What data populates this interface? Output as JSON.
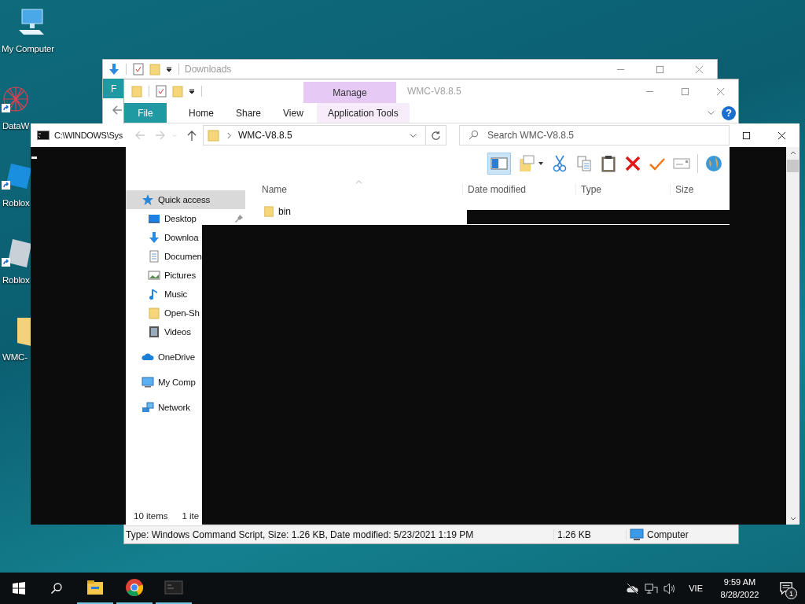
{
  "desktop_icons": [
    {
      "label": "My Computer",
      "kind": "computer",
      "shortcut": false
    },
    {
      "label": "DataW",
      "kind": "web",
      "shortcut": true
    },
    {
      "label": "Roblox",
      "kind": "tile",
      "shortcut": true
    },
    {
      "label": "Roblox",
      "kind": "studio",
      "shortcut": true
    },
    {
      "label": "WMC-",
      "kind": "folder",
      "shortcut": false
    }
  ],
  "downloads_window": {
    "title": "Downloads",
    "tab": "F"
  },
  "explorer": {
    "title": "WMC-V8.8.5",
    "active": false,
    "context_group": "Manage",
    "tabs": [
      {
        "label": "File",
        "kind": "file"
      },
      {
        "label": "Home",
        "kind": "tab"
      },
      {
        "label": "Share",
        "kind": "tab"
      },
      {
        "label": "View",
        "kind": "tab"
      },
      {
        "label": "Application Tools",
        "kind": "contextual"
      }
    ],
    "help": "?",
    "address": "WMC-V8.8.5",
    "search": {
      "placeholder": "Search WMC-V8.8.5"
    },
    "preview_pane_on": true,
    "columns": [
      "Name",
      "Date modified",
      "Type",
      "Size"
    ],
    "nav": [
      {
        "label": "Quick access",
        "kind": "star",
        "selected": true,
        "pinned": false
      },
      {
        "label": "Desktop",
        "kind": "desktop",
        "selected": false,
        "pinned": true
      },
      {
        "label": "Downloa",
        "kind": "download",
        "selected": false,
        "pinned": false
      },
      {
        "label": "Documen",
        "kind": "document",
        "selected": false,
        "pinned": false
      },
      {
        "label": "Pictures",
        "kind": "picture",
        "selected": false,
        "pinned": false
      },
      {
        "label": "Music",
        "kind": "music",
        "selected": false,
        "pinned": false
      },
      {
        "label": "Open-Sh",
        "kind": "folder",
        "selected": false,
        "pinned": false
      },
      {
        "label": "Videos",
        "kind": "video",
        "selected": false,
        "pinned": false
      },
      {
        "label": "OneDrive",
        "kind": "cloud",
        "selected": false,
        "pinned": false
      },
      {
        "label": "My Comp",
        "kind": "computer",
        "selected": false,
        "pinned": false
      },
      {
        "label": "Network",
        "kind": "network",
        "selected": false,
        "pinned": false
      }
    ],
    "files": [
      {
        "name": "bin"
      }
    ],
    "item_count": "10 items",
    "selection_count": "1 ite",
    "status": {
      "details": "Type: Windows Command Script, Size: 1.26 KB, Date modified: 5/23/2021 1:19 PM",
      "size": "1.26 KB",
      "zone": "Computer"
    }
  },
  "console": {
    "title": "C:\\WINDOWS\\Sys"
  },
  "taskbar": {
    "apps": [
      {
        "kind": "explorer",
        "running": true
      },
      {
        "kind": "chrome",
        "running": true
      },
      {
        "kind": "console",
        "running": true
      }
    ],
    "language": "VIE",
    "time": "9:59 AM",
    "date": "8/28/2022",
    "notifications": "1"
  }
}
